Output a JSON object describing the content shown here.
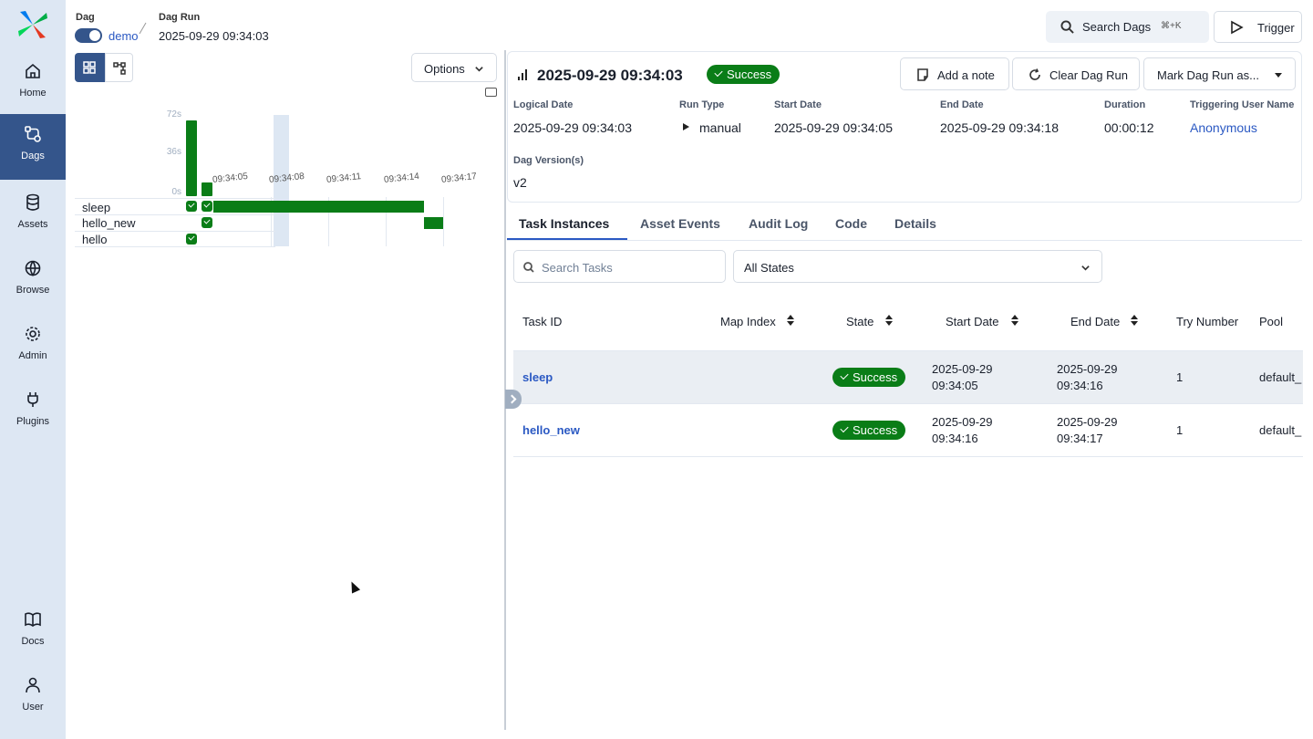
{
  "sidebar": {
    "items": [
      {
        "label": "Home",
        "icon": "home-icon"
      },
      {
        "label": "Dags",
        "icon": "dags-icon"
      },
      {
        "label": "Assets",
        "icon": "database-icon"
      },
      {
        "label": "Browse",
        "icon": "globe-icon"
      },
      {
        "label": "Admin",
        "icon": "gear-icon"
      },
      {
        "label": "Plugins",
        "icon": "plug-icon"
      },
      {
        "label": "Docs",
        "icon": "book-icon"
      },
      {
        "label": "User",
        "icon": "user-icon"
      }
    ],
    "active": "Dags"
  },
  "breadcrumb": {
    "dag_label": "Dag",
    "dag_name": "demo",
    "run_label": "Dag Run",
    "run_value": "2025-09-29 09:34:03"
  },
  "header": {
    "search_label": "Search Dags",
    "search_shortcut": "⌘+K",
    "trigger_label": "Trigger"
  },
  "left_pane": {
    "options_label": "Options",
    "grid": {
      "y_ticks": [
        "72s",
        "36s",
        "0s"
      ],
      "time_ticks": [
        "09:34:05",
        "09:34:08",
        "09:34:11",
        "09:34:14",
        "09:34:17"
      ],
      "tasks": [
        "sleep",
        "hello_new",
        "hello"
      ],
      "run_durations_s": [
        66,
        12
      ]
    }
  },
  "run": {
    "title": "2025-09-29 09:34:03",
    "status": "Success",
    "buttons": {
      "add_note": "Add a note",
      "clear": "Clear Dag Run",
      "mark": "Mark Dag Run as..."
    },
    "meta": [
      {
        "label": "Logical Date",
        "value": "2025-09-29 09:34:03"
      },
      {
        "label": "Run Type",
        "value": "manual"
      },
      {
        "label": "Start Date",
        "value": "2025-09-29 09:34:05"
      },
      {
        "label": "End Date",
        "value": "2025-09-29 09:34:18"
      },
      {
        "label": "Duration",
        "value": "00:00:12"
      },
      {
        "label": "Triggering User Name",
        "value": "Anonymous"
      }
    ],
    "version_label": "Dag Version(s)",
    "version_value": "v2"
  },
  "tabs": [
    "Task Instances",
    "Asset Events",
    "Audit Log",
    "Code",
    "Details"
  ],
  "active_tab": "Task Instances",
  "filters": {
    "search_placeholder": "Search Tasks",
    "state_value": "All States"
  },
  "table": {
    "columns": [
      "Task ID",
      "Map Index",
      "State",
      "Start Date",
      "End Date",
      "Try Number",
      "Pool"
    ],
    "rows": [
      {
        "task_id": "sleep",
        "state": "Success",
        "start_date": "2025-09-29",
        "start_time": "09:34:05",
        "end_date": "2025-09-29",
        "end_time": "09:34:16",
        "try_number": "1",
        "pool": "default_"
      },
      {
        "task_id": "hello_new",
        "state": "Success",
        "start_date": "2025-09-29",
        "start_time": "09:34:16",
        "end_date": "2025-09-29",
        "end_time": "09:34:17",
        "try_number": "1",
        "pool": "default_"
      }
    ]
  },
  "colors": {
    "success": "#0a7d17",
    "sidebar_bg": "#dde7f3",
    "active_nav": "#34558b",
    "link": "#2b59c3"
  }
}
